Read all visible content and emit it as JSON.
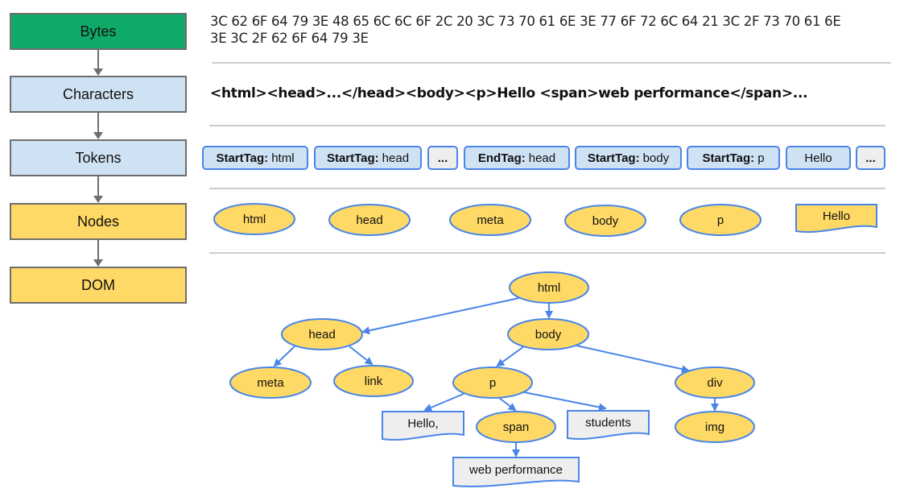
{
  "colors": {
    "bytes_fill": "#0fa968",
    "blue_fill": "#cfe2f3",
    "yellow_fill": "#ffd966",
    "grey_fill": "#eeeeee",
    "edge_blue": "#4a86e8",
    "stage_border": "#6e6e6e"
  },
  "stages": [
    {
      "label": "Bytes"
    },
    {
      "label": "Characters"
    },
    {
      "label": "Tokens"
    },
    {
      "label": "Nodes"
    },
    {
      "label": "DOM"
    }
  ],
  "bytes_text": "3C 62 6F 64 79 3E 48 65 6C 6C 6F 2C 20 3C 73 70 61 6E 3E 77 6F 72 6C 64 21 3C 2F 73 70 61 6E 3E 3C 2F 62 6F 64 79 3E",
  "characters_text": "<html><head>...</head><body><p>Hello <span>web performance</span>...",
  "tokens": [
    {
      "kind": "StartTag:",
      "value": "html"
    },
    {
      "kind": "StartTag:",
      "value": "head"
    },
    {
      "kind": "",
      "value": "..."
    },
    {
      "kind": "EndTag:",
      "value": "head"
    },
    {
      "kind": "StartTag:",
      "value": "body"
    },
    {
      "kind": "StartTag:",
      "value": "p"
    },
    {
      "kind": "",
      "value": "Hello"
    },
    {
      "kind": "",
      "value": "..."
    }
  ],
  "nodes": [
    {
      "label": "html",
      "shape": "ellipse"
    },
    {
      "label": "head",
      "shape": "ellipse"
    },
    {
      "label": "meta",
      "shape": "ellipse"
    },
    {
      "label": "body",
      "shape": "ellipse"
    },
    {
      "label": "p",
      "shape": "ellipse"
    },
    {
      "label": "Hello",
      "shape": "document"
    }
  ],
  "dom_tree": {
    "nodes": [
      {
        "id": "html",
        "label": "html",
        "shape": "ellipse"
      },
      {
        "id": "head",
        "label": "head",
        "shape": "ellipse"
      },
      {
        "id": "body",
        "label": "body",
        "shape": "ellipse"
      },
      {
        "id": "meta",
        "label": "meta",
        "shape": "ellipse"
      },
      {
        "id": "link",
        "label": "link",
        "shape": "ellipse"
      },
      {
        "id": "p",
        "label": "p",
        "shape": "ellipse"
      },
      {
        "id": "div",
        "label": "div",
        "shape": "ellipse"
      },
      {
        "id": "hello",
        "label": "Hello,",
        "shape": "document"
      },
      {
        "id": "span",
        "label": "span",
        "shape": "ellipse"
      },
      {
        "id": "students",
        "label": "students",
        "shape": "document"
      },
      {
        "id": "img",
        "label": "img",
        "shape": "ellipse"
      },
      {
        "id": "webperf",
        "label": "web performance",
        "shape": "document"
      }
    ],
    "edges": [
      [
        "html",
        "head"
      ],
      [
        "html",
        "body"
      ],
      [
        "head",
        "meta"
      ],
      [
        "head",
        "link"
      ],
      [
        "body",
        "p"
      ],
      [
        "body",
        "div"
      ],
      [
        "p",
        "hello"
      ],
      [
        "p",
        "span"
      ],
      [
        "p",
        "students"
      ],
      [
        "span",
        "webperf"
      ],
      [
        "div",
        "img"
      ]
    ]
  }
}
